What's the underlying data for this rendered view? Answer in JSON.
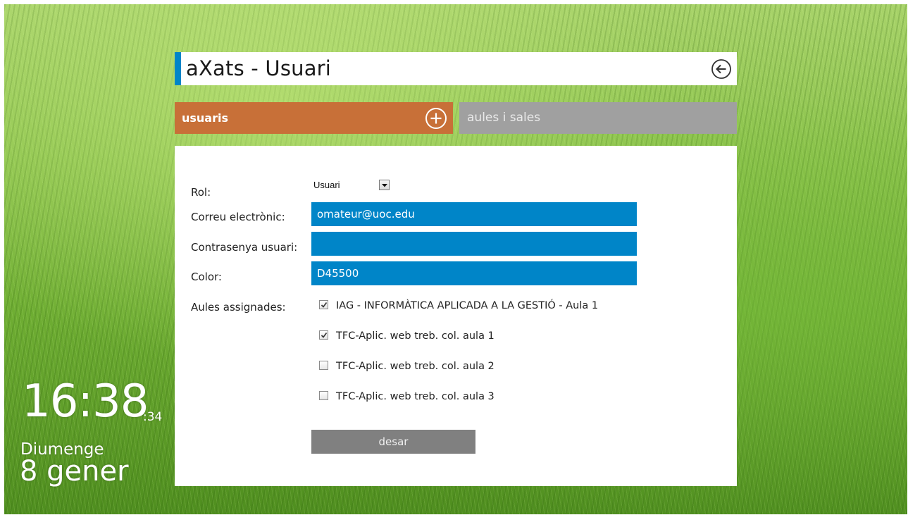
{
  "app": {
    "title": "aXats - Usuari"
  },
  "tabs": [
    {
      "label": "usuaris",
      "active": true
    },
    {
      "label": "aules i sales",
      "active": false
    }
  ],
  "form": {
    "rol": {
      "label": "Rol:",
      "value": "Usuari"
    },
    "email": {
      "label": "Correu electrònic:",
      "value": "omateur@uoc.edu"
    },
    "password": {
      "label": "Contrasenya usuari:",
      "value": ""
    },
    "color": {
      "label": "Color:",
      "value": "D45500"
    },
    "aules": {
      "label": "Aules assignades:",
      "items": [
        {
          "label": "IAG - INFORMÀTICA APLICADA A LA GESTIÓ - Aula 1",
          "checked": true
        },
        {
          "label": "TFC-Aplic. web treb. col. aula 1",
          "checked": true
        },
        {
          "label": "TFC-Aplic. web treb. col. aula 2",
          "checked": false
        },
        {
          "label": "TFC-Aplic. web treb. col. aula 3",
          "checked": false
        }
      ]
    },
    "save_label": "desar"
  },
  "clock": {
    "time": "16:38",
    "seconds": ":34",
    "day": "Diumenge",
    "date": "8 gener"
  },
  "colors": {
    "accent_blue": "#0085c8",
    "tab_active": "#c87038",
    "tab_inactive": "#a0a0a0",
    "button_gray": "#808080"
  },
  "icons": {
    "back": "back-arrow-circle-icon",
    "add": "plus-circle-icon",
    "dropdown": "triangle-down-icon",
    "check": "checkmark-icon"
  }
}
